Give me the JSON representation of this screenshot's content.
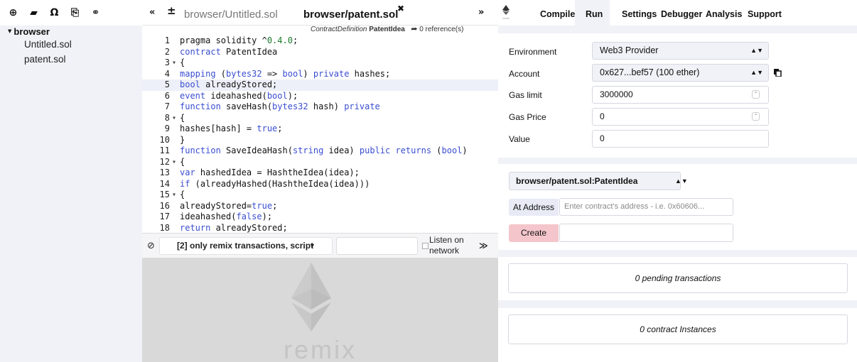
{
  "explorer": {
    "toolbar": [
      {
        "icon": "add-file-icon",
        "glyph": "⊕"
      },
      {
        "icon": "open-folder-icon",
        "glyph": "▰"
      },
      {
        "icon": "github-icon",
        "glyph": "Ω"
      },
      {
        "icon": "copy-to-gist-icon",
        "glyph": "⎘"
      },
      {
        "icon": "connect-localhost-icon",
        "glyph": "⚭"
      }
    ],
    "root_label": "browser",
    "files": [
      "Untitled.sol",
      "patent.sol"
    ]
  },
  "editor": {
    "tabs": [
      {
        "label": "browser/Untitled.sol",
        "active": false
      },
      {
        "label": "browser/patent.sol",
        "active": true
      }
    ],
    "context": {
      "type": "ContractDefinition",
      "name": "PatentIdea",
      "references": "0 reference(s)"
    },
    "lines": [
      {
        "n": "1",
        "fold": "",
        "html": "pragma solidity ^<span class=\"num\">0.4.0</span>;"
      },
      {
        "n": "2",
        "fold": "",
        "html": "<span class=\"kw\">contract</span> PatentIdea"
      },
      {
        "n": "3",
        "fold": "▾",
        "html": "{"
      },
      {
        "n": "4",
        "fold": "",
        "html": "<span class=\"kw\">mapping</span> (<span class=\"kw\">bytes32</span> =&gt; <span class=\"kw\">bool</span>) <span class=\"kw\">private</span> hashes;"
      },
      {
        "n": "5",
        "fold": "",
        "html": "<span class=\"kw\">bool</span> alreadyStored;",
        "hl": true
      },
      {
        "n": "6",
        "fold": "",
        "html": "<span class=\"kw\">event</span> ideahashed(<span class=\"kw\">bool</span>);"
      },
      {
        "n": "7",
        "fold": "",
        "html": "<span class=\"kw\">function</span> saveHash(<span class=\"kw\">bytes32</span> hash) <span class=\"kw\">private</span>"
      },
      {
        "n": "8",
        "fold": "▾",
        "html": "{"
      },
      {
        "n": "9",
        "fold": "",
        "html": "hashes[hash] = <span class=\"kw\">true</span>;"
      },
      {
        "n": "10",
        "fold": "",
        "html": "}"
      },
      {
        "n": "11",
        "fold": "",
        "html": "<span class=\"kw\">function</span> SaveIdeaHash(<span class=\"kw\">string</span> idea) <span class=\"kw\">public</span> <span class=\"kw\">returns</span> (<span class=\"kw\">bool</span>)"
      },
      {
        "n": "12",
        "fold": "▾",
        "html": "{"
      },
      {
        "n": "13",
        "fold": "",
        "html": "<span class=\"kw\">var</span> hashedIdea = HashtheIdea(idea);"
      },
      {
        "n": "14",
        "fold": "",
        "html": "<span class=\"kw\">if</span> (alreadyHashed(HashtheIdea(idea)))"
      },
      {
        "n": "15",
        "fold": "▾",
        "html": "{"
      },
      {
        "n": "16",
        "fold": "",
        "html": "alreadyStored=<span class=\"kw\">true</span>;"
      },
      {
        "n": "17",
        "fold": "",
        "html": "ideahashed(<span class=\"kw\">false</span>);"
      },
      {
        "n": "18",
        "fold": "",
        "html": "<span class=\"kw\">return</span> alreadyStored;"
      }
    ]
  },
  "terminal": {
    "filter_value": "[2] only remix transactions, script",
    "listen_label": "Listen on network",
    "listen_checked": false,
    "watermark": "remix"
  },
  "menu": {
    "logo_text": "remix",
    "items": [
      "Compile",
      "Run",
      "Settings",
      "Debugger",
      "Analysis",
      "Support"
    ],
    "active": "Run"
  },
  "run": {
    "environment": {
      "label": "Environment",
      "value": "Web3 Provider"
    },
    "account": {
      "label": "Account",
      "value": "0x627...bef57 (100 ether)"
    },
    "gas_limit": {
      "label": "Gas limit",
      "value": "3000000"
    },
    "gas_price": {
      "label": "Gas Price",
      "value": "0"
    },
    "value": {
      "label": "Value",
      "value": "0"
    },
    "contract_select": "browser/patent.sol:PatentIdea",
    "at_address_label": "At Address",
    "at_address_placeholder": "Enter contract's address - i.e. 0x60606...",
    "create_label": "Create",
    "pending": "0 pending transactions",
    "instances": "0 contract Instances"
  },
  "colors": {
    "keyword": "#3a4ed0",
    "number": "#1a7a2a",
    "panel_bg": "#f1f2f7",
    "create_button": "#f4c6cb"
  }
}
